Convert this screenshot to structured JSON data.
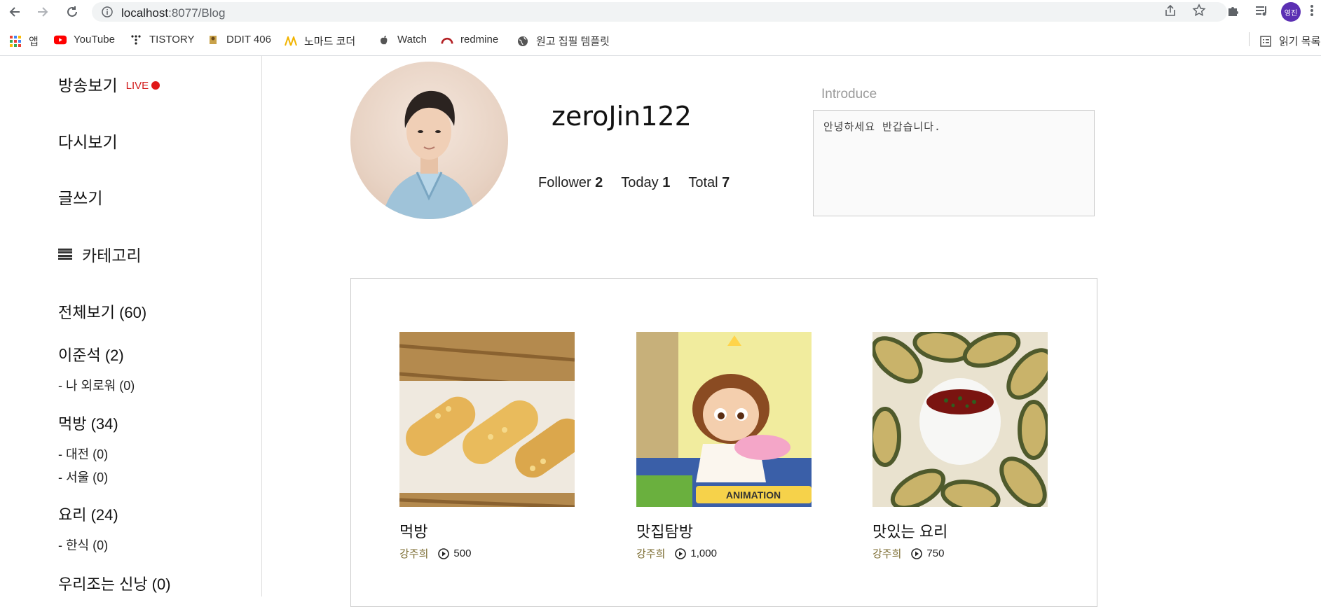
{
  "browser": {
    "url_host": "localhost",
    "url_rest": ":8077/Blog",
    "profile_initials": "영진"
  },
  "bookmarks": [
    {
      "label": "앱",
      "icon": "apps-grid-icon"
    },
    {
      "label": "YouTube",
      "icon": "youtube-icon"
    },
    {
      "label": "TISTORY",
      "icon": "tistory-icon"
    },
    {
      "label": "DDIT 406",
      "icon": "ddit-icon"
    },
    {
      "label": "노마드 코더",
      "icon": "nomad-icon"
    },
    {
      "label": "Watch",
      "icon": "apple-icon"
    },
    {
      "label": "redmine",
      "icon": "redmine-icon"
    },
    {
      "label": "원고 집필 템플릿",
      "icon": "globe-icon"
    }
  ],
  "reading_list_label": "읽기 목록",
  "sidebar": {
    "live_label": "방송보기",
    "live_badge": "LIVE",
    "replay_label": "다시보기",
    "write_label": "글쓰기",
    "category_header": "카테고리",
    "categories": [
      {
        "label": "전체보기 (60)",
        "subs": []
      },
      {
        "label": "이준석 (2)",
        "subs": [
          "- 나 외로워 (0)"
        ]
      },
      {
        "label": "먹방 (34)",
        "subs": [
          "- 대전 (0)",
          "- 서울 (0)"
        ]
      },
      {
        "label": "요리 (24)",
        "subs": [
          "- 한식 (0)"
        ]
      },
      {
        "label": "우리조는 신낭 (0)",
        "subs": []
      }
    ]
  },
  "profile": {
    "username": "zeroJin122",
    "follower_label": "Follower",
    "follower_count": "2",
    "today_label": "Today",
    "today_count": "1",
    "total_label": "Total",
    "total_count": "7",
    "introduce_label": "Introduce",
    "introduce_text": "안녕하세요 반갑습니다."
  },
  "posts": [
    {
      "title": "먹방",
      "author": "강주희",
      "views": "500",
      "thumb": "corn-rolls"
    },
    {
      "title": "맛집탐방",
      "author": "강주희",
      "views": "1,000",
      "thumb": "cartoon-girl"
    },
    {
      "title": "맛있는 요리",
      "author": "강주희",
      "views": "750",
      "thumb": "eggplant-dish"
    }
  ],
  "colors": {
    "live_red": "#e01818",
    "author_color": "#7a6a2e",
    "avatar_bg": "#5b2fb3"
  }
}
